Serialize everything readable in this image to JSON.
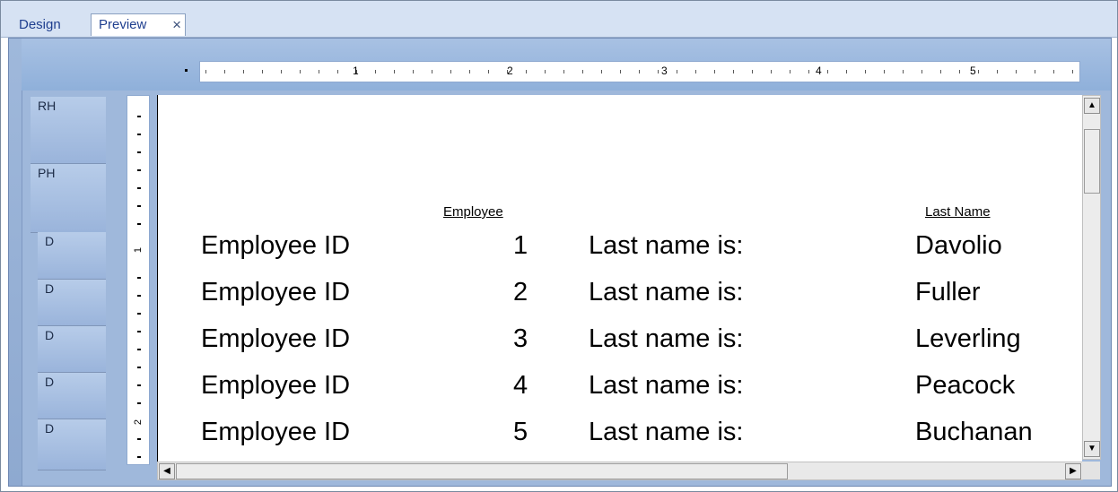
{
  "tabs": {
    "design_label": "Design",
    "preview_label": "Preview",
    "close_glyph": "×"
  },
  "ruler": {
    "numbers": [
      "1",
      "2",
      "3",
      "4",
      "5"
    ]
  },
  "vertical_ruler": {
    "numbers": [
      "1",
      "2"
    ]
  },
  "sections": {
    "rh": "RH",
    "ph": "PH",
    "d": [
      "D",
      "D",
      "D",
      "D",
      "D"
    ]
  },
  "headers": {
    "employee": "Employee",
    "last_name": "Last Name"
  },
  "rows": [
    {
      "label1": "Employee ID",
      "id": "1",
      "label2": "Last name is:",
      "last_name": "Davolio"
    },
    {
      "label1": "Employee ID",
      "id": "2",
      "label2": "Last name is:",
      "last_name": "Fuller"
    },
    {
      "label1": "Employee ID",
      "id": "3",
      "label2": "Last name is:",
      "last_name": "Leverling"
    },
    {
      "label1": "Employee ID",
      "id": "4",
      "label2": "Last name is:",
      "last_name": "Peacock"
    },
    {
      "label1": "Employee ID",
      "id": "5",
      "label2": "Last name is:",
      "last_name": "Buchanan"
    }
  ],
  "icons": {
    "scroll_up": "▲",
    "scroll_down": "▼",
    "scroll_left": "◀",
    "scroll_right": "▶"
  },
  "colors": {
    "tab_text": "#1f3f8f",
    "workspace_bg": "#9fb8db"
  }
}
